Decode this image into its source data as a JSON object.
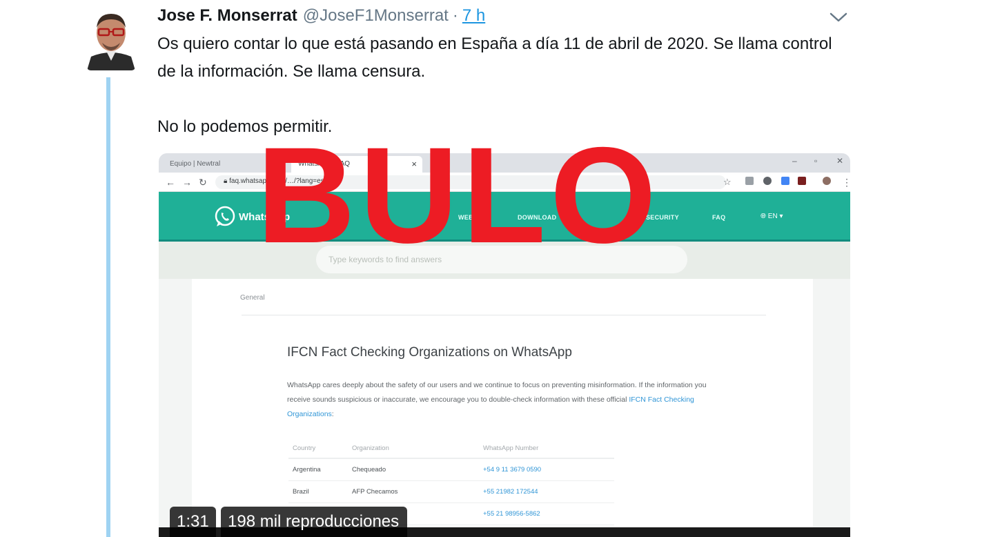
{
  "tweet": {
    "author_name": "Jose F. Monserrat",
    "author_handle": "@JoseF1Monserrat",
    "separator": "·",
    "time": "7 h",
    "text_line1": "Os quiero contar lo que está pasando en España a día 11 de abril de 2020. Se llama control de la información. Se llama censura.",
    "text_line2": "No lo podemos permitir."
  },
  "overlay": {
    "stamp": "BULO",
    "stamp_color": "#ed1c24"
  },
  "video": {
    "duration": "1:31",
    "views": "198 mil reproducciones"
  },
  "screenshot": {
    "browser": {
      "tab1_title": "Equipo | Newtral",
      "tab2_title": "WhatsApp · FAQ",
      "url": "faq.whatsapp.com/…/?lang=es · 983"
    },
    "whatsapp": {
      "brand": "WhatsApp",
      "nav_web": "WEB",
      "nav_download": "DOWNLOAD",
      "nav_security": "SECURITY",
      "nav_faq": "FAQ",
      "lang": "EN",
      "search_placeholder": "Type keywords to find answers",
      "breadcrumb": "General",
      "article_title": "IFCN Fact Checking Organizations on WhatsApp",
      "article_body": "WhatsApp cares deeply about the safety of our users and we continue to focus on preventing misinformation. If the information you receive sounds suspicious or inaccurate, we encourage you to double-check information with these official",
      "article_link": "IFCN Fact Checking Organizations",
      "article_end": ":",
      "table_headers": [
        "Country",
        "Organization",
        "WhatsApp Number"
      ],
      "table_rows": [
        {
          "country": "Argentina",
          "org": "Chequeado",
          "number": "+54 9 11 3679 0590"
        },
        {
          "country": "Brazil",
          "org": "AFP Checamos",
          "number": "+55 21982 172544"
        },
        {
          "country": "",
          "org": "",
          "number": "+55 21 98956-5862"
        }
      ]
    }
  },
  "colors": {
    "twitter_blue": "#1b95e0",
    "thread_line": "#9fd3f2",
    "whatsapp_teal": "#1fb097"
  }
}
